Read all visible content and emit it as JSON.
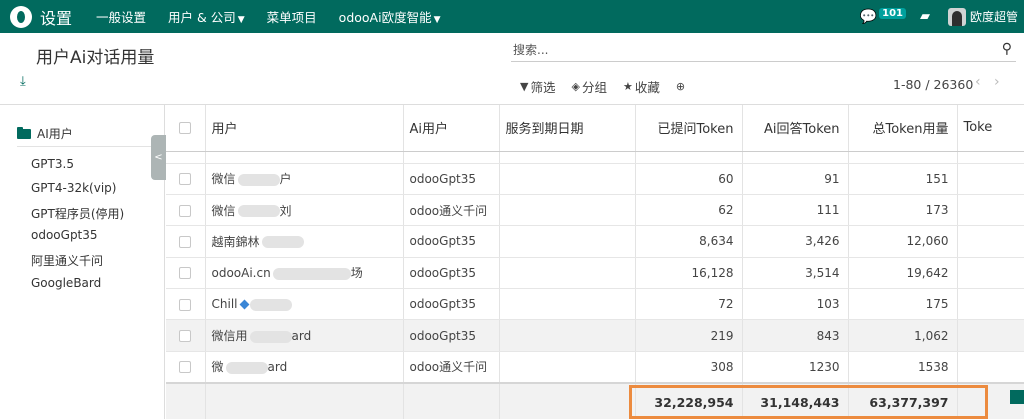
{
  "navbar": {
    "app_name": "设置",
    "menus": [
      {
        "label": "一般设置",
        "dropdown": false
      },
      {
        "label": "用户 & 公司",
        "dropdown": true
      },
      {
        "label": "菜单项目",
        "dropdown": false
      },
      {
        "label": "odooAi欧度智能",
        "dropdown": true
      }
    ],
    "chat_count": "101",
    "user_name": "欧度超管"
  },
  "control_panel": {
    "title": "用户Ai对话用量",
    "search_placeholder": "搜索...",
    "filter_label": "筛选",
    "group_label": "分组",
    "favorite_label": "收藏",
    "pager": "1-80 / 26360"
  },
  "side_panel": {
    "header": "AI用户",
    "items": [
      "GPT3.5",
      "GPT4-32k(vip)",
      "GPT程序员(停用)",
      "odooGpt35",
      "阿里通义千问",
      "GoogleBard"
    ]
  },
  "table": {
    "columns": [
      "用户",
      "Ai用户",
      "服务到期日期",
      "已提问Token",
      "Ai回答Token",
      "总Token用量",
      "Toke"
    ],
    "rows": [
      {
        "user": "微信",
        "user_tail": "户",
        "ai_user": "odooGpt35",
        "asked": "60",
        "answered": "91",
        "total": "151"
      },
      {
        "user": "微信",
        "user_tail": "刘",
        "ai_user": "odoo通义千问",
        "asked": "62",
        "answered": "111",
        "total": "173"
      },
      {
        "user": "越南錦林",
        "user_tail": "",
        "ai_user": "odooGpt35",
        "asked": "8,634",
        "answered": "3,426",
        "total": "12,060"
      },
      {
        "user": "odooAi.cn",
        "user_tail": "场",
        "ai_user": "odooGpt35",
        "asked": "16,128",
        "answered": "3,514",
        "total": "19,642"
      },
      {
        "user": "Chill",
        "user_tail": "",
        "ai_user": "odooGpt35",
        "asked": "72",
        "answered": "103",
        "total": "175"
      },
      {
        "user": "微信用",
        "user_tail": "ard",
        "ai_user": "odooGpt35",
        "asked": "219",
        "answered": "843",
        "total": "1,062"
      },
      {
        "user": "微",
        "user_tail": "ard",
        "ai_user": "odoo通义千问",
        "asked": "308",
        "answered": "1230",
        "total": "1538"
      }
    ],
    "totals": {
      "asked": "32,228,954",
      "answered": "31,148,443",
      "total": "63,377,397"
    }
  },
  "colors": {
    "brand": "#016a5e",
    "highlight": "#ec8b3f",
    "badge": "#00a09d"
  }
}
